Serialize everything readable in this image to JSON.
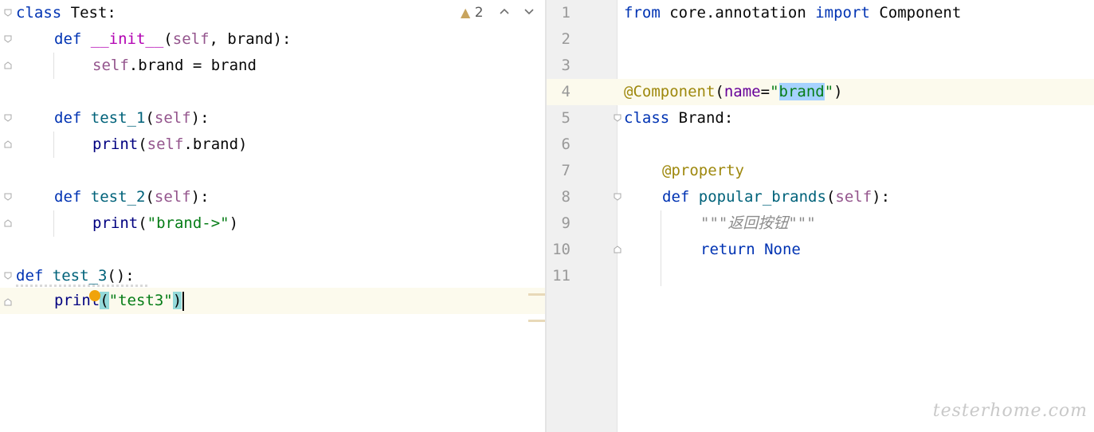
{
  "left_editor": {
    "inspection_count": "2",
    "lines": {
      "l1_kw": "class",
      "l1_name": " Test:",
      "l2_kw": "def",
      "l2_fn": "__init__",
      "l2_open": "(",
      "l2_self": "self",
      "l2_rest": ", brand):",
      "l3_self": "self",
      "l3_rest": ".brand = brand",
      "l5_kw": "def",
      "l5_fn": "test_1",
      "l5_open": "(",
      "l5_self": "self",
      "l5_rest": "):",
      "l6_fn": "print",
      "l6_open": "(",
      "l6_self": "self",
      "l6_rest": ".brand)",
      "l8_kw": "def",
      "l8_fn": "test_2",
      "l8_open": "(",
      "l8_self": "self",
      "l8_rest": "):",
      "l9_fn": "print",
      "l9_open": "(",
      "l9_str": "\"brand->\"",
      "l9_close": ")",
      "l11_kw": "def",
      "l11_fn": "test_3",
      "l11_rest": "():",
      "l12_fn": "print",
      "l12_open": "(",
      "l12_str": "\"test3\"",
      "l12_close": ")"
    }
  },
  "right_editor": {
    "line_numbers": [
      "1",
      "2",
      "3",
      "4",
      "5",
      "6",
      "7",
      "8",
      "9",
      "10",
      "11"
    ],
    "lines": {
      "r1_kw1": "from",
      "r1_mod": " core.annotation ",
      "r1_kw2": "import",
      "r1_name": " Component",
      "r4_dec": "@Component",
      "r4_open": "(",
      "r4_param": "name",
      "r4_eq": "=",
      "r4_q1": "\"",
      "r4_val": "brand",
      "r4_q2": "\"",
      "r4_close": ")",
      "r5_kw": "class",
      "r5_name": " Brand:",
      "r7_dec": "@property",
      "r8_kw": "def",
      "r8_fn": "popular_brands",
      "r8_open": "(",
      "r8_self": "self",
      "r8_rest": "):",
      "r9_doc": "\"\"\"返回按钮\"\"\"",
      "r10_kw": "return",
      "r10_none": "None"
    }
  },
  "watermark": "testerhome.com"
}
